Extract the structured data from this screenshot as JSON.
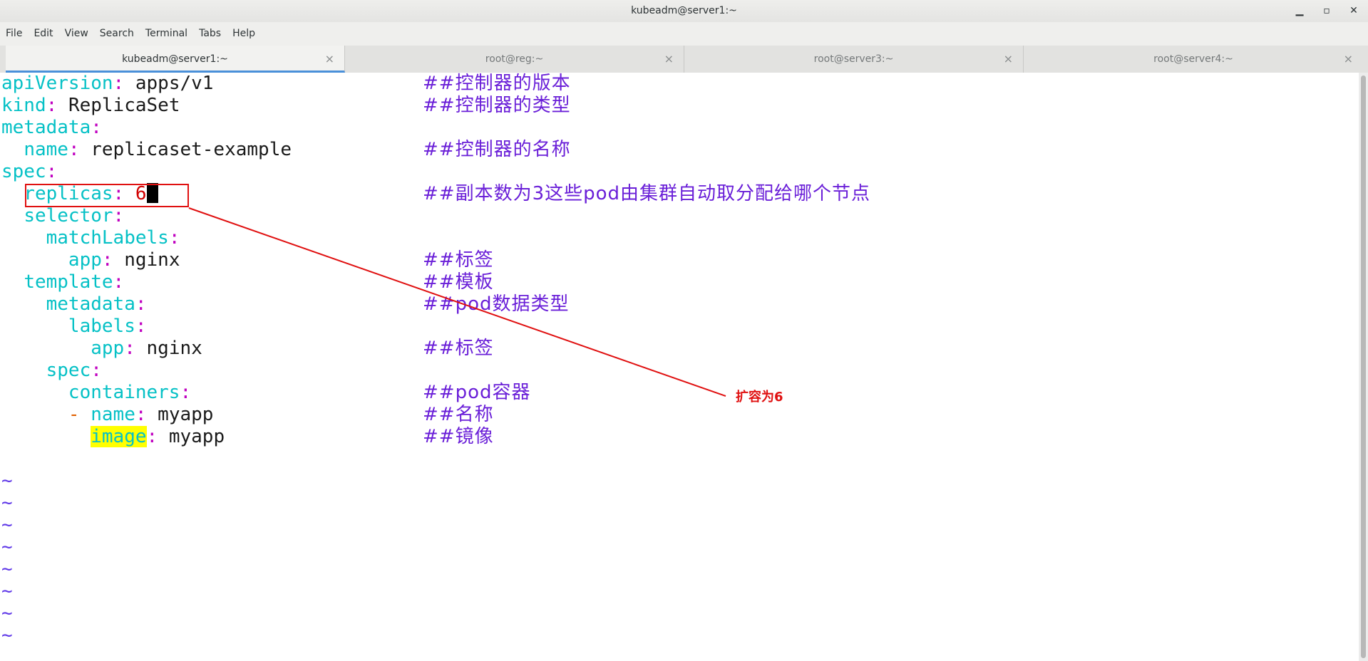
{
  "window": {
    "title": "kubeadm@server1:~",
    "minimize": "▁",
    "maximize": "▫",
    "close": "✕"
  },
  "menu": [
    "File",
    "Edit",
    "View",
    "Search",
    "Terminal",
    "Tabs",
    "Help"
  ],
  "tabs": [
    {
      "label": "kubeadm@server1:~",
      "active": true
    },
    {
      "label": "root@reg:~",
      "active": false
    },
    {
      "label": "root@server3:~",
      "active": false
    },
    {
      "label": "root@server4:~",
      "active": false
    }
  ],
  "tab_close": "×",
  "yaml": {
    "l0": {
      "key": "apiVersion",
      "value": "apps/v1",
      "comment": "##控制器的版本"
    },
    "l1": {
      "key": "kind",
      "value": "ReplicaSet",
      "comment": "##控制器的类型"
    },
    "l2": {
      "key": "metadata"
    },
    "l3": {
      "key": "name",
      "value": "replicaset-example",
      "comment": "##控制器的名称"
    },
    "l4": {
      "key": "spec"
    },
    "l5": {
      "key": "replicas",
      "value": "6",
      "comment": "##副本数为3这些pod由集群自动取分配给哪个节点"
    },
    "l6": {
      "key": "selector"
    },
    "l7": {
      "key": "matchLabels"
    },
    "l8": {
      "key": "app",
      "value": "nginx",
      "comment": "##标签"
    },
    "l9": {
      "key": "template",
      "comment": "##模板"
    },
    "l10": {
      "key": "metadata",
      "comment": "##pod数据类型"
    },
    "l11": {
      "key": "labels"
    },
    "l12": {
      "key": "app",
      "value": "nginx",
      "comment": "##标签"
    },
    "l13": {
      "key": "spec"
    },
    "l14": {
      "key": "containers",
      "comment": "##pod容器"
    },
    "l15": {
      "dash": "-",
      "key": "name",
      "value": "myapp",
      "comment": "##名称"
    },
    "l16": {
      "key": "image",
      "value": "myapp",
      "comment": "##镜像"
    }
  },
  "colon": ":",
  "tilde": "~",
  "annotation": {
    "text": "扩容为6"
  }
}
